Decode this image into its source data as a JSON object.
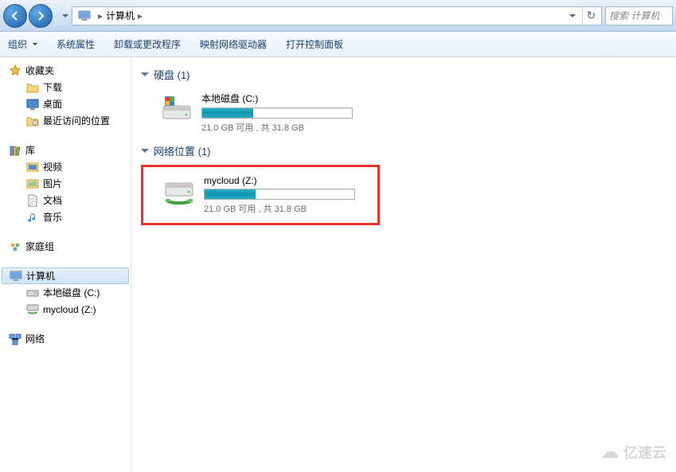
{
  "nav": {
    "location": "计算机",
    "search_placeholder": "搜索 计算机"
  },
  "toolbar": {
    "organize": "组织",
    "system_props": "系统属性",
    "uninstall": "卸载或更改程序",
    "map_drive": "映射网络驱动器",
    "control_panel": "打开控制面板"
  },
  "sidebar": {
    "favorites": {
      "label": "收藏夹",
      "items": [
        "下载",
        "桌面",
        "最近访问的位置"
      ]
    },
    "libraries": {
      "label": "库",
      "items": [
        "视频",
        "图片",
        "文档",
        "音乐"
      ]
    },
    "homegroup": {
      "label": "家庭组"
    },
    "computer": {
      "label": "计算机",
      "items": [
        "本地磁盘 (C:)",
        "mycloud (Z:)"
      ]
    },
    "network": {
      "label": "网络"
    }
  },
  "content": {
    "hard_disks": {
      "label": "硬盘 (1)"
    },
    "network_locations": {
      "label": "网络位置 (1)"
    },
    "drives": [
      {
        "name": "本地磁盘 (C:)",
        "stats": "21.0 GB 可用 , 共 31.8 GB",
        "fill_pct": 34
      },
      {
        "name": "mycloud (Z:)",
        "stats": "21.0 GB 可用 , 共 31.8 GB",
        "fill_pct": 34
      }
    ]
  },
  "watermark": "亿速云"
}
